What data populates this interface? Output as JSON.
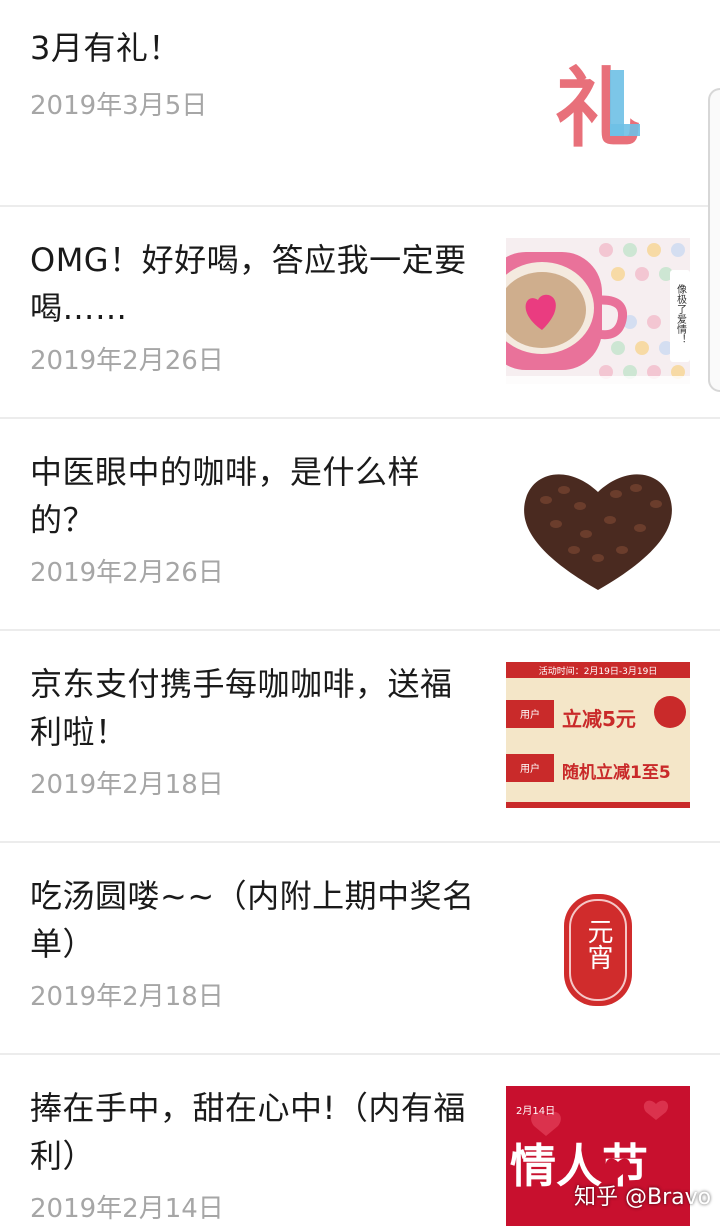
{
  "articles": [
    {
      "title": "3月有礼！",
      "date": "2019年3月5日",
      "thumb_icon": "gift-char-icon",
      "thumb_text": "礼"
    },
    {
      "title": "OMG！好好喝，答应我一定要喝……",
      "date": "2019年2月26日",
      "thumb_icon": "coffee-cup-heart-icon",
      "thumb_text": "像极了爱情！"
    },
    {
      "title": "中医眼中的咖啡，是什么样的？",
      "date": "2019年2月26日",
      "thumb_icon": "coffee-bean-heart-icon"
    },
    {
      "title": "京东支付携手每咖咖啡，送福利啦！",
      "date": "2019年2月18日",
      "thumb_icon": "promo-banner-icon",
      "promo": {
        "period": "活动时间：2月19日-3月19日",
        "tag1": "用户",
        "offer1": "立减5元",
        "tag2": "用户",
        "offer2": "随机立减1至5"
      }
    },
    {
      "title": "吃汤圆喽~~（内附上期中奖名单）",
      "date": "2019年2月18日",
      "thumb_icon": "lantern-seal-icon",
      "thumb_text": "元宵"
    },
    {
      "title": "捧在手中，甜在心中!（内有福利）",
      "date": "2019年2月14日",
      "thumb_icon": "valentine-card-icon",
      "thumb_text": "情人节",
      "thumb_date": "2月14日"
    }
  ],
  "watermark": "知乎 @Bravo",
  "colors": {
    "title": "#1a1a1a",
    "date": "#a6a6a6",
    "separator": "#ececec"
  }
}
